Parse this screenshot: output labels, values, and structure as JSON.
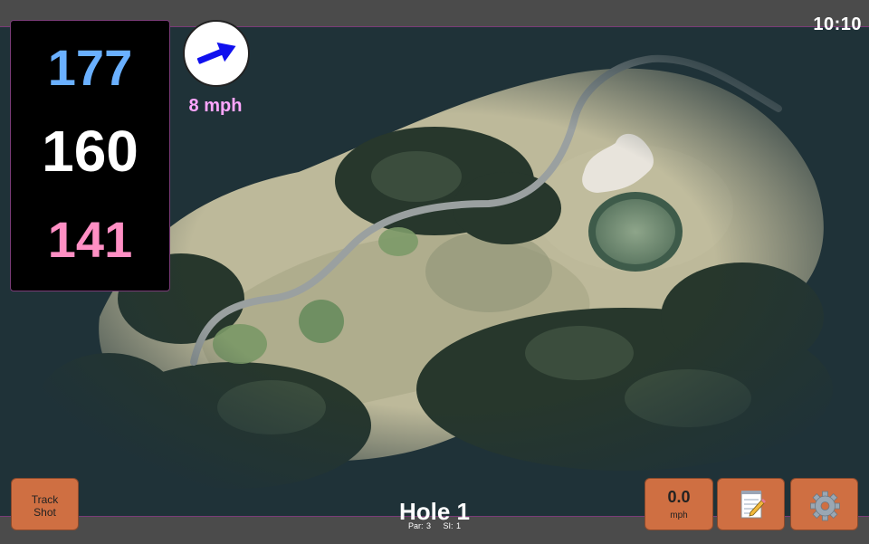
{
  "clock": "10:10",
  "distances": {
    "back": "177",
    "middle": "160",
    "front": "141",
    "colors": {
      "back": "#6ab0ff",
      "middle": "#ffffff",
      "front": "#ff8fc4"
    }
  },
  "wind": {
    "speed_label": "8 mph",
    "direction_icon": "arrow-icon",
    "arrow_color": "#1010ee",
    "label_color": "#ffa6ff"
  },
  "hole": {
    "title": "Hole 1",
    "par_label": "Par: 3",
    "si_label": "SI: 1"
  },
  "buttons": {
    "track_shot_line1": "Track",
    "track_shot_line2": "Shot",
    "speed_value": "0.0",
    "speed_unit": "mph",
    "notes_icon": "notepad-icon",
    "settings_icon": "gear-icon",
    "color": "#cf6f42"
  }
}
